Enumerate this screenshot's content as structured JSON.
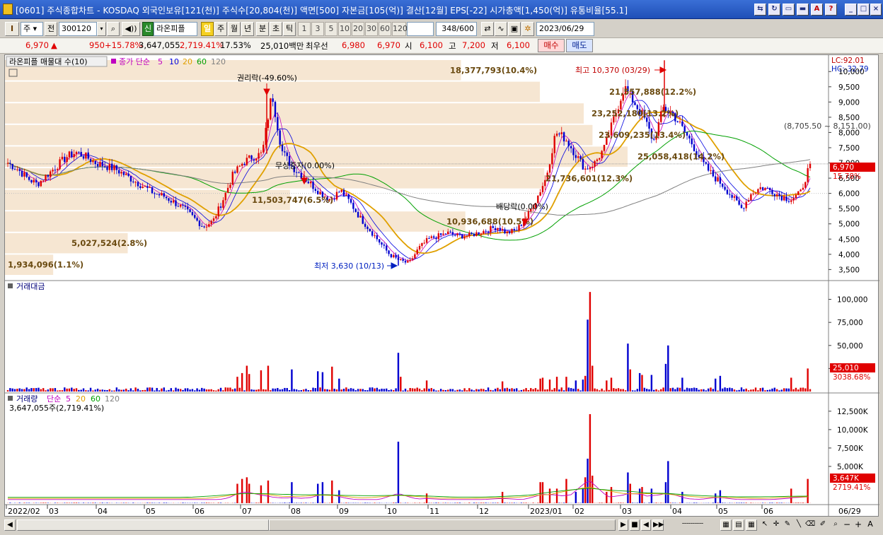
{
  "window": {
    "title": "[0601] 주식종합차트 - KOSDAQ 외국인보유[121(천)] 주식수[20,804(천)] 액면[500] 자본금[105(억)] 결산[12월] EPS[-22] 시가총액[1,450(억)] 유통비율[55.1]"
  },
  "toolbar": {
    "period_select": "주",
    "prev_label": "전",
    "code_value": "300120",
    "stock_name": "라온피플",
    "stock_badge": "신",
    "periods": [
      "일",
      "주",
      "월",
      "년",
      "분",
      "초",
      "틱"
    ],
    "minute_units": [
      "1",
      "3",
      "5",
      "10",
      "20",
      "30",
      "60",
      "120"
    ],
    "count_value": "348",
    "count_total": "/600",
    "date_value": "2023/06/29"
  },
  "quote": {
    "price": "6,970",
    "arrow": "▲",
    "change": "950",
    "change_pct": "+15.78%",
    "volume": "3,647,055",
    "volume_pct": "2,719.41%",
    "turnover": "17.53%",
    "amount": "25,010백만",
    "pref_label": "최우선",
    "bid": "6,980",
    "ask": "6,970",
    "open_label": "시",
    "open": "6,100",
    "high_label": "고",
    "high": "7,200",
    "low_label": "저",
    "low": "6,100",
    "buy_label": "매수",
    "sell_label": "매도"
  },
  "price_panel": {
    "indicator_label": "라온피플 매물대 수(10)",
    "ma_label": "종가 단순",
    "ma_periods": [
      "5",
      "10",
      "20",
      "60",
      "120"
    ],
    "ma_colors": [
      "#c000c0",
      "#0000e0",
      "#e0a000",
      "#00a000",
      "#808080"
    ],
    "lc_label": "LC:92.01",
    "hc_label": "HC:-32.79",
    "y_ticks": [
      "10,000",
      "9,500",
      "9,000",
      "8,500",
      "8,000",
      "7,500",
      "7,000",
      "6,500",
      "6,000",
      "5,500",
      "5,000",
      "4,500",
      "4,000",
      "3,500"
    ],
    "current_price_tag": "6,970",
    "current_pct_tag": "15.78%",
    "volume_profile": [
      {
        "label": "1,934,096(1.1%)"
      },
      {
        "label": "5,027,524(2.8%)"
      },
      {
        "label": "10,936,688(10.5%)"
      },
      {
        "label": "11,503,747(6.5%)"
      },
      {
        "label": "21,736,601(12.3%)"
      },
      {
        "label": "25,058,418(14.2%)"
      },
      {
        "label": "23,609,235(13.4%)"
      },
      {
        "label": "23,252,180(13.2%)"
      },
      {
        "label": "21,557,888(12.2%)"
      },
      {
        "label": "18,377,793(10.4%)"
      }
    ],
    "range_label": "(8,705.50 ~ 8,151.00)",
    "annotations": {
      "rights": "권리락(-49.60%)",
      "bonus": "무상증자(0.00%)",
      "dividend": "배당락(0.00%)",
      "high": "최고 10,370 (03/29)",
      "low": "최저 3,630 (10/13)"
    }
  },
  "amount_panel": {
    "label": "거래대금",
    "y_ticks": [
      "100,000",
      "75,000",
      "50,000",
      "25,000"
    ],
    "current_tag": "25,010",
    "pct_tag": "3038.68%"
  },
  "volume_panel": {
    "label": "거래량",
    "ma_label": "단순",
    "ma_periods": [
      "5",
      "20",
      "60",
      "120"
    ],
    "current_text": "3,647,055주(2,719.41%)",
    "y_ticks": [
      "12,500K",
      "10,000K",
      "7,500K",
      "5,000K"
    ],
    "current_tag": "3,647K",
    "pct_tag": "2719.41%"
  },
  "x_axis": {
    "labels": [
      "2022/02",
      "03",
      "04",
      "05",
      "06",
      "07",
      "08",
      "09",
      "10",
      "11",
      "12",
      "2023/01",
      "02",
      "03",
      "04",
      "05",
      "06"
    ],
    "right_label": "06/29"
  },
  "chart_data": {
    "type": "candlestick",
    "period": "daily",
    "y_range": [
      3300,
      10400
    ],
    "close_path": [
      7000,
      6800,
      6500,
      6300,
      6600,
      6900,
      7200,
      7350,
      7200,
      7000,
      6900,
      6800,
      6600,
      6400,
      6200,
      6000,
      5900,
      5700,
      5500,
      5200,
      4900,
      5100,
      5800,
      6600,
      7000,
      7200,
      7300,
      9300,
      7400,
      6900,
      6600,
      6300,
      6000,
      5800,
      6100,
      5700,
      5200,
      4800,
      4400,
      4000,
      3800,
      3700,
      4200,
      4500,
      4600,
      4700,
      4600,
      4600,
      4700,
      4800,
      4900,
      4700,
      4800,
      5200,
      5800,
      6500,
      8000,
      7800,
      7300,
      6800,
      7000,
      7500,
      8500,
      9500,
      9000,
      8500,
      7700,
      8800,
      8600,
      8100,
      7600,
      7000,
      6600,
      6300,
      5900,
      5500,
      6000,
      6200,
      6100,
      5900,
      5800,
      6000,
      6970
    ],
    "volume_profile_percent": [
      1.1,
      2.8,
      10.5,
      6.5,
      12.3,
      14.2,
      13.4,
      13.2,
      12.2,
      10.4
    ],
    "high": {
      "value": 10370,
      "date": "03/29"
    },
    "low": {
      "value": 3630,
      "date": "10/13"
    },
    "last_close": 6970
  }
}
